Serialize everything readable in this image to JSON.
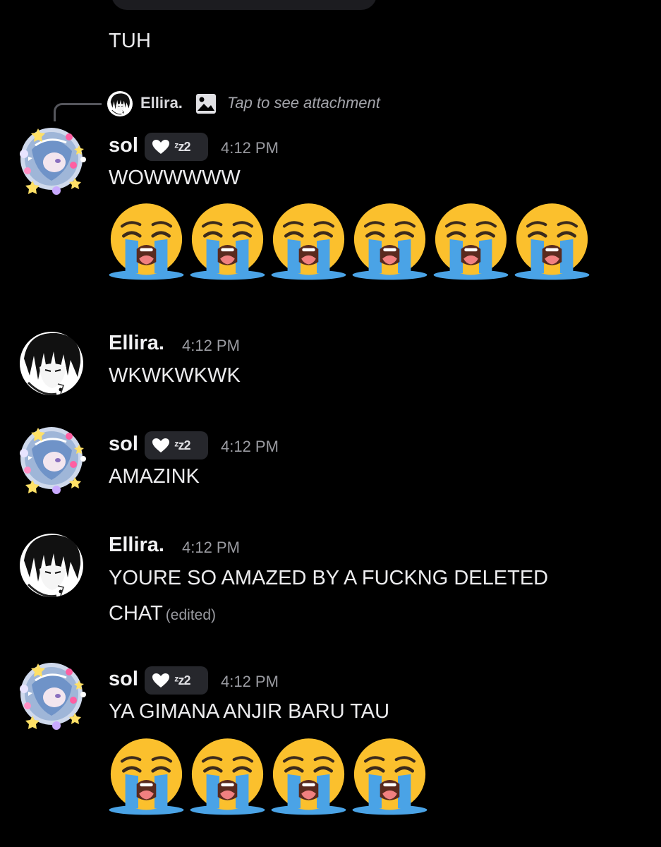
{
  "top_message": {
    "text": "TUH"
  },
  "reply_preview": {
    "author": "Ellira.",
    "attachment_icon": "image-icon",
    "text": "Tap to see attachment"
  },
  "messages": [
    {
      "author": "sol",
      "badge": {
        "icon": "white-heart-icon",
        "text": "ᶻz᠌2"
      },
      "time": "4:12 PM",
      "text": "WOWWWWW",
      "emoji": {
        "name": "loudly-crying-face",
        "count": 6
      }
    },
    {
      "author": "Ellira.",
      "time": "4:12 PM",
      "text": "WKWKWKWK"
    },
    {
      "author": "sol",
      "badge": {
        "icon": "white-heart-icon",
        "text": "ᶻz᠌2"
      },
      "time": "4:12 PM",
      "text": "AMAZINK"
    },
    {
      "author": "Ellira.",
      "time": "4:12 PM",
      "text_line1": "YOURE SO AMAZED BY A FUCKNG DELETED",
      "text_line2": "CHAT",
      "edited": "(edited)"
    },
    {
      "author": "sol",
      "badge": {
        "icon": "white-heart-icon",
        "text": "ᶻz᠌2"
      },
      "time": "4:12 PM",
      "text": "YA GIMANA ANJIR BARU TAU",
      "emoji": {
        "name": "loudly-crying-face",
        "count": 4
      }
    }
  ],
  "colors": {
    "background": "#000000",
    "badge_bg": "#26272c",
    "timestamp": "#9a9ba1",
    "emoji_face": "#fbc02d",
    "emoji_tears": "#4aa3e6"
  }
}
